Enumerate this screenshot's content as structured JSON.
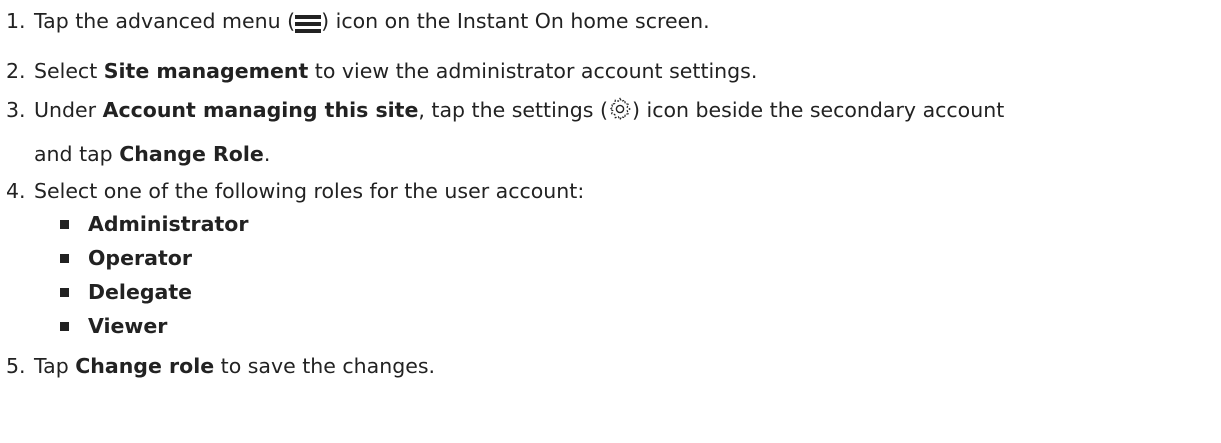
{
  "steps": [
    {
      "num": "1.",
      "pre": "Tap the advanced menu (",
      "post": ") icon on the Instant On home screen.",
      "icon": "hamburger-menu-icon"
    },
    {
      "num": "2.",
      "pre": "Select ",
      "bold": "Site management",
      "post": " to view the administrator account settings."
    },
    {
      "num": "3.",
      "pre": "Under ",
      "bold": "Account managing this site",
      "mid": ", tap the settings (",
      "post": ") icon beside the secondary account",
      "icon": "gear-icon",
      "cont_pre": "and tap ",
      "cont_bold": "Change Role",
      "cont_post": "."
    },
    {
      "num": "4.",
      "text": "Select one of the following roles for the user account:"
    },
    {
      "num": "5.",
      "pre": "Tap ",
      "bold": "Change role",
      "post": " to save the changes."
    }
  ],
  "roles": [
    "Administrator",
    "Operator",
    "Delegate",
    "Viewer"
  ]
}
